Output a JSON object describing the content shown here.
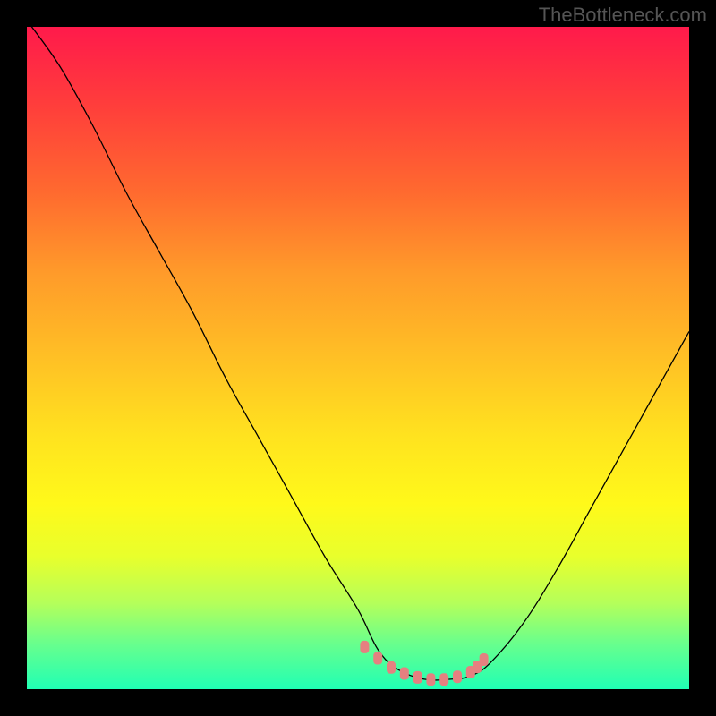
{
  "watermark": "TheBottleneck.com",
  "colors": {
    "black": "#000000",
    "curve": "#000000",
    "marker": "#e58080"
  },
  "chart_data": {
    "type": "line",
    "title": "",
    "xlabel": "",
    "ylabel": "",
    "xlim": [
      0,
      100
    ],
    "ylim": [
      0,
      100
    ],
    "series": [
      {
        "name": "bottleneck-curve",
        "x": [
          0,
          5,
          10,
          15,
          20,
          25,
          30,
          35,
          40,
          45,
          50,
          53,
          56,
          60,
          64,
          67,
          70,
          75,
          80,
          85,
          90,
          95,
          100
        ],
        "y": [
          101,
          94,
          85,
          75,
          66,
          57,
          47,
          38,
          29,
          20,
          12,
          6,
          3,
          1.5,
          1.5,
          2,
          4,
          10,
          18,
          27,
          36,
          45,
          54
        ]
      },
      {
        "name": "optimal-band-markers",
        "x": [
          51,
          53,
          55,
          57,
          59,
          61,
          63,
          65,
          67,
          68,
          69
        ],
        "y": [
          6.5,
          4.8,
          3.4,
          2.5,
          1.9,
          1.6,
          1.6,
          2.0,
          2.7,
          3.5,
          4.6
        ]
      }
    ],
    "annotations": []
  }
}
